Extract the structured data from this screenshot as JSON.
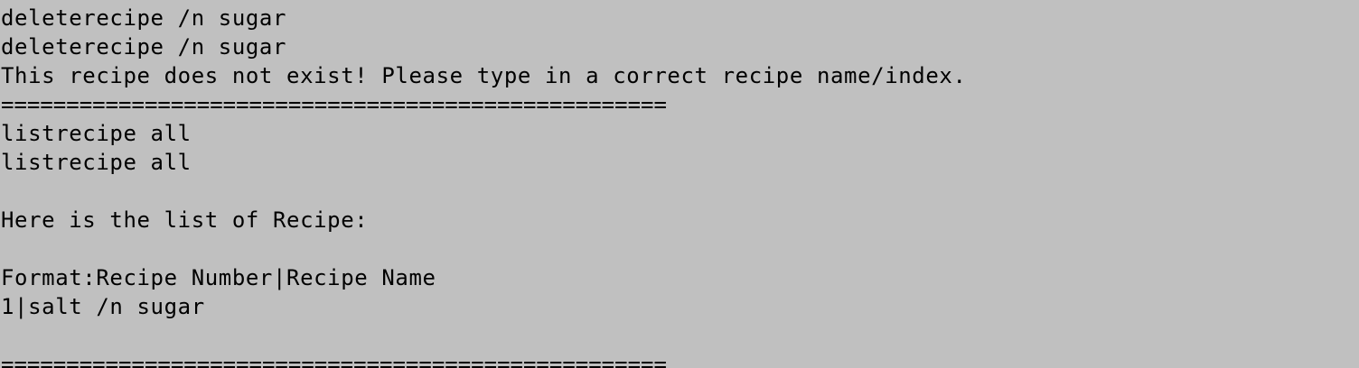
{
  "terminal": {
    "lines": [
      "deleterecipe /n sugar",
      "deleterecipe /n sugar",
      "This recipe does not exist! Please type in a correct recipe name/index.",
      "===================================================",
      "listrecipe all",
      "listrecipe all",
      "",
      "Here is the list of Recipe:",
      "",
      "Format:Recipe Number|Recipe Name",
      "1|salt /n sugar",
      "",
      "==================================================="
    ]
  },
  "colors": {
    "background": "#c0c0c0",
    "text": "#000000"
  }
}
